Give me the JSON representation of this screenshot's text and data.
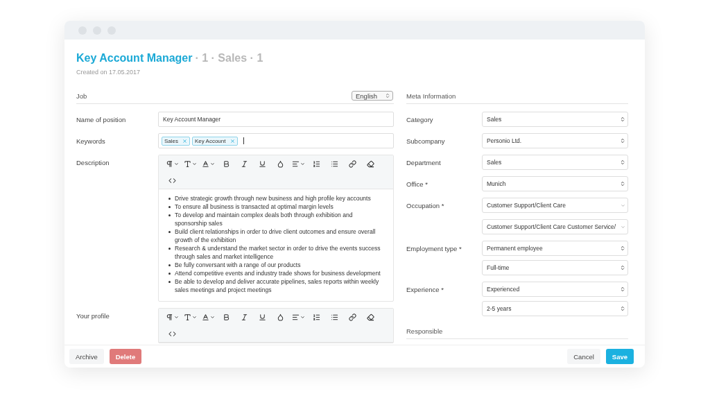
{
  "header": {
    "title": "Key Account Manager",
    "meta": "· 1 · Sales · 1",
    "created": "Created on 17.05.2017"
  },
  "job": {
    "heading": "Job",
    "language": "English",
    "fields": [
      {
        "label": "Name of position",
        "kind": "text",
        "value": "Key Account Manager"
      },
      {
        "label": "Keywords",
        "kind": "tags",
        "tags": [
          "Sales",
          "Key Account"
        ]
      },
      {
        "label": "Description",
        "kind": "editor",
        "bullets": [
          "Drive strategic growth through new business and high profile key accounts",
          "To ensure all business is transacted at optimal margin levels",
          "To develop and maintain complex deals both through exhibition and sponsorship sales",
          "Build client relationships in order to drive client outcomes and ensure overall growth of the exhibition",
          "Research & understand the market sector in order to drive the events success through sales and market intelligence",
          "Be fully conversant with a range of our products",
          "Attend competitive events and industry trade shows for business development",
          "Be able to develop and deliver accurate pipelines, sales reports within weekly sales meetings and project meetings"
        ]
      },
      {
        "label": "Your profile",
        "kind": "editor"
      }
    ]
  },
  "meta": {
    "heading": "Meta Information",
    "fields": [
      {
        "label": "Category",
        "selects": [
          {
            "value": "Sales",
            "kind": "native"
          }
        ]
      },
      {
        "label": "Subcompany",
        "selects": [
          {
            "value": "Personio Ltd.",
            "kind": "native"
          }
        ]
      },
      {
        "label": "Department",
        "selects": [
          {
            "value": "Sales",
            "kind": "native"
          }
        ]
      },
      {
        "label": "Office *",
        "selects": [
          {
            "value": "Munich",
            "kind": "native"
          }
        ]
      },
      {
        "label": "Occupation *",
        "selects": [
          {
            "value": "Customer Support/Client Care",
            "kind": "combo"
          },
          {
            "value": "Customer Support/Client Care Customer Service/",
            "kind": "combo"
          }
        ]
      },
      {
        "label": "Employment type *",
        "selects": [
          {
            "value": "Permanent employee",
            "kind": "native"
          },
          {
            "value": "Full-time",
            "kind": "native"
          }
        ]
      },
      {
        "label": "Experience *",
        "selects": [
          {
            "value": "Experienced",
            "kind": "native"
          },
          {
            "value": "2-5 years",
            "kind": "native"
          }
        ]
      }
    ]
  },
  "responsible": {
    "heading": "Responsible"
  },
  "footer": {
    "left": [
      {
        "label": "Archive",
        "kind": "default"
      },
      {
        "label": "Delete",
        "kind": "danger"
      }
    ],
    "right": [
      {
        "label": "Cancel",
        "kind": "default"
      },
      {
        "label": "Save",
        "kind": "primary"
      }
    ]
  }
}
